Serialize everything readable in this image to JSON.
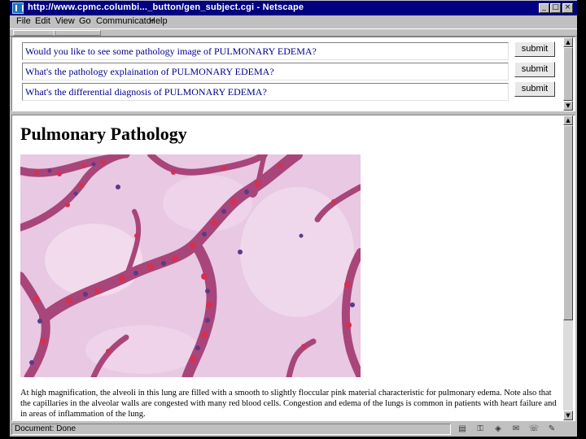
{
  "window": {
    "title": "http://www.cpmc.columbi..._button/gen_subject.cgi - Netscape"
  },
  "menu": [
    "File",
    "Edit",
    "View",
    "Go",
    "Communicator",
    "Help"
  ],
  "questions": [
    {
      "text": "Would you like to see some pathology image of PULMONARY EDEMA?",
      "button": "submit"
    },
    {
      "text": "What's the pathology explaination of PULMONARY EDEMA?",
      "button": "submit"
    },
    {
      "text": "What's the differential diagnosis of PULMONARY EDEMA?",
      "button": "submit"
    }
  ],
  "content": {
    "heading": "Pulmonary Pathology",
    "caption": "At high magnification, the alveoli in this lung are filled with a smooth to slightly floccular pink material characteristic for pulmonary edema. Note also that the capillaries in the alveolar walls are congested with many red blood cells. Congestion and edema of the lungs is common in patients with heart failure and in areas of inflammation of the lung."
  },
  "status": {
    "text": "Document: Done"
  },
  "colors": {
    "titlebar": "#000080",
    "link_text": "#000090",
    "tissue_background": "#e8c8e2",
    "septa": "#a8457a",
    "rbc": "#d63050"
  }
}
